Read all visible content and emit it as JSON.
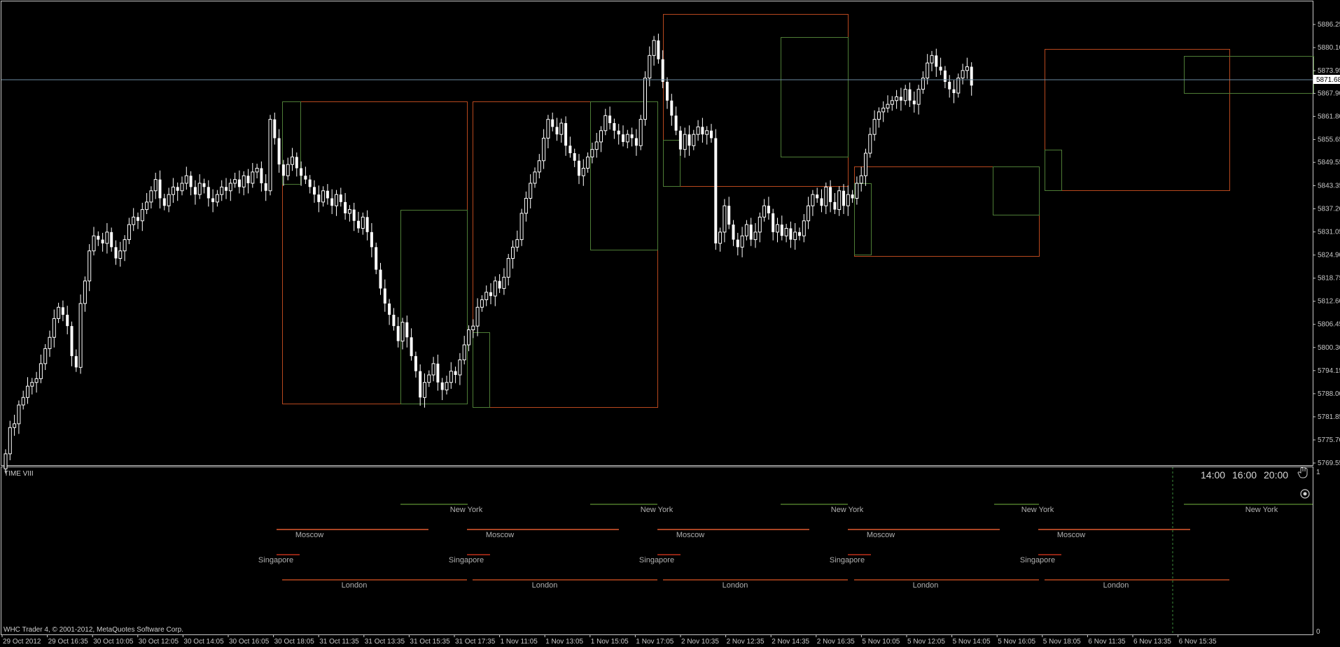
{
  "window": {
    "indicator_title": "TIME VIII",
    "copyright": "WHC Trader 4, © 2001-2012, MetaQuotes Software Corp.",
    "sub_scale_top": "1",
    "sub_scale_bottom": "0",
    "clock_times": [
      "14:00",
      "16:00",
      "20:00"
    ]
  },
  "colors": {
    "background": "#000000",
    "frame": "#c8c8c8",
    "candle": "#ffffff",
    "box_orange": "#b8481e",
    "box_green": "#4e7d36",
    "bid_line": "#6b8aa0",
    "newyork_line": "#4f7a2a",
    "moscow_line": "#e05a30",
    "singapore_line": "#c0301a",
    "london_line": "#b8481e"
  },
  "chart_data": {
    "type": "candlestick",
    "symbol_current_price": "5871.68",
    "price_axis_labels": [
      "5886.25",
      "5880.10",
      "5873.95",
      "5867.90",
      "5861.80",
      "5855.65",
      "5849.55",
      "5843.35",
      "5837.20",
      "5831.05",
      "5824.90",
      "5818.75",
      "5812.60",
      "5806.45",
      "5800.30",
      "5794.15",
      "5788.00",
      "5781.85",
      "5775.70",
      "5769.55"
    ],
    "ylim": [
      5769.55,
      5886.25
    ],
    "time_axis_labels": [
      "29 Oct 2012",
      "29 Oct 16:35",
      "30 Oct 10:05",
      "30 Oct 12:05",
      "30 Oct 14:05",
      "30 Oct 16:05",
      "30 Oct 18:05",
      "31 Oct 11:35",
      "31 Oct 13:35",
      "31 Oct 15:35",
      "31 Oct 17:35",
      "1 Nov 11:05",
      "1 Nov 13:05",
      "1 Nov 15:05",
      "1 Nov 17:05",
      "2 Nov 10:35",
      "2 Nov 12:35",
      "2 Nov 14:35",
      "2 Nov 16:35",
      "5 Nov 10:05",
      "5 Nov 12:05",
      "5 Nov 14:05",
      "5 Nov 16:05",
      "5 Nov 18:05",
      "6 Nov 11:35",
      "6 Nov 13:35",
      "6 Nov 15:35"
    ],
    "closes": [
      5772,
      5779,
      5780,
      5785,
      5787,
      5790,
      5791,
      5792,
      5796,
      5800,
      5803,
      5808,
      5811,
      5809,
      5806,
      5798,
      5795,
      5812,
      5818,
      5826,
      5830,
      5829,
      5828,
      5831,
      5827,
      5824,
      5826,
      5829,
      5833,
      5835,
      5834,
      5837,
      5839,
      5842,
      5845,
      5840,
      5838,
      5841,
      5843,
      5842,
      5844,
      5846,
      5843,
      5841,
      5844,
      5843,
      5840,
      5839,
      5841,
      5843,
      5842,
      5844,
      5845,
      5843,
      5846,
      5844,
      5847,
      5848,
      5844,
      5842,
      5861,
      5856,
      5849,
      5846,
      5849,
      5851,
      5848,
      5846,
      5845,
      5843,
      5841,
      5839,
      5842,
      5840,
      5838,
      5841,
      5839,
      5836,
      5837,
      5834,
      5832,
      5835,
      5831,
      5827,
      5821,
      5816,
      5812,
      5809,
      5806,
      5802,
      5807,
      5803,
      5798,
      5794,
      5787,
      5791,
      5793,
      5796,
      5791,
      5789,
      5791,
      5794,
      5793,
      5797,
      5801,
      5805,
      5806,
      5811,
      5813,
      5815,
      5814,
      5818,
      5816,
      5819,
      5824,
      5827,
      5829,
      5836,
      5840,
      5844,
      5847,
      5850,
      5856,
      5861,
      5859,
      5857,
      5860,
      5854,
      5852,
      5850,
      5846,
      5848,
      5851,
      5853,
      5855,
      5858,
      5862,
      5860,
      5858,
      5857,
      5855,
      5857,
      5856,
      5854,
      5861,
      5872,
      5878,
      5882,
      5877,
      5871,
      5866,
      5862,
      5858,
      5853,
      5857,
      5854,
      5857,
      5859,
      5857,
      5858,
      5856,
      5828,
      5831,
      5838,
      5833,
      5829,
      5827,
      5830,
      5833,
      5829,
      5831,
      5835,
      5838,
      5836,
      5831,
      5833,
      5830,
      5832,
      5829,
      5831,
      5830,
      5834,
      5838,
      5841,
      5840,
      5838,
      5843,
      5839,
      5837,
      5842,
      5838,
      5841,
      5840,
      5844,
      5846,
      5852,
      5857,
      5861,
      5863,
      5864,
      5865,
      5866,
      5867,
      5866,
      5869,
      5866,
      5865,
      5869,
      5872,
      5876,
      5878,
      5875,
      5874,
      5871,
      5869,
      5868,
      5872,
      5874,
      5875,
      5870
    ]
  },
  "sessions": [
    {
      "name": "New York",
      "color_key": "newyork_line"
    },
    {
      "name": "Moscow",
      "color_key": "moscow_line"
    },
    {
      "name": "Singapore",
      "color_key": "singapore_line"
    },
    {
      "name": "London",
      "color_key": "london_line"
    }
  ],
  "session_labels": {
    "new_york": [
      "New York",
      "New York",
      "New York",
      "New York",
      "New York"
    ],
    "moscow": [
      "Moscow",
      "Moscow",
      "Moscow",
      "Moscow",
      "Moscow"
    ],
    "singapore": [
      "Singapore",
      "Singapore",
      "Singapore",
      "Singapore",
      "Singapore"
    ],
    "london": [
      "London",
      "London",
      "London",
      "London",
      "London"
    ]
  },
  "icons": [
    "hand-cursor-icon",
    "target-icon"
  ]
}
